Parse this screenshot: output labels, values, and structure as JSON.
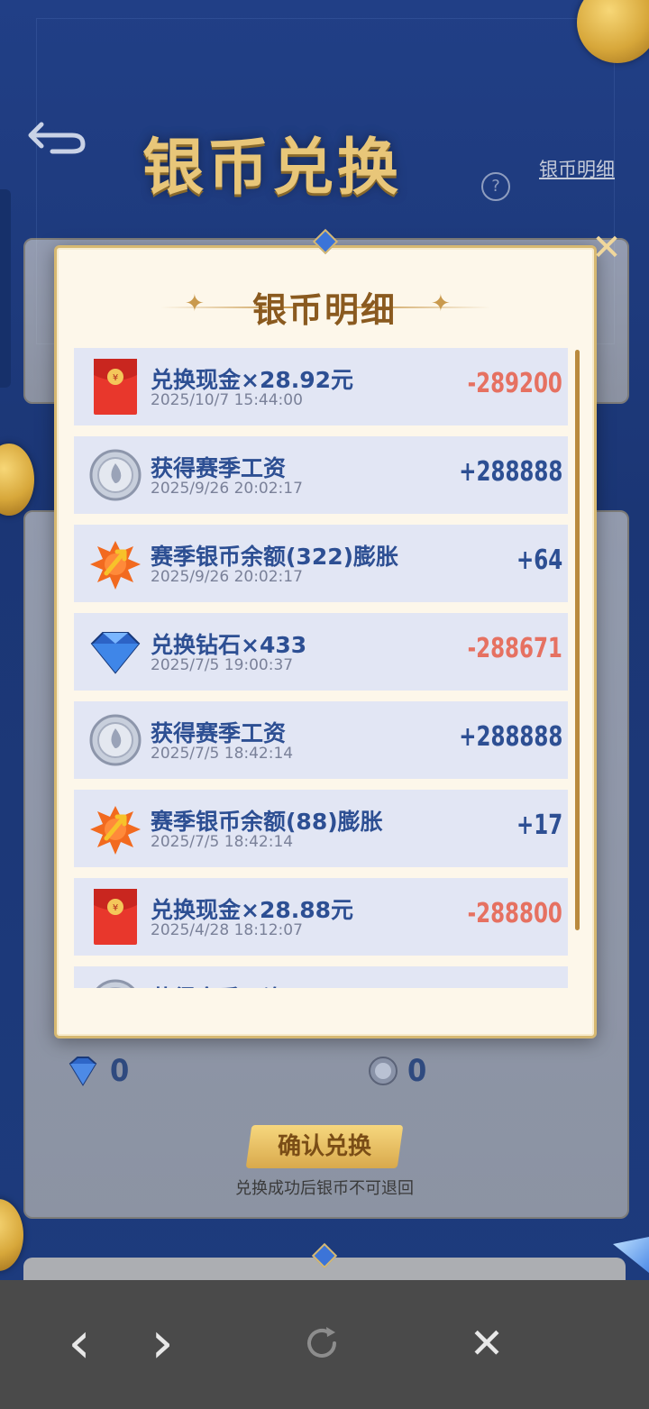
{
  "header": {
    "title": "银币兑换",
    "help_symbol": "?",
    "detail_link": "银币明细"
  },
  "modal": {
    "title": "银币明细",
    "close_symbol": "✕",
    "records": [
      {
        "icon": "red-envelope-icon",
        "title": "兑换现金×28.92元",
        "time": "2025/10/7 15:44:00",
        "amount": "-289200",
        "sign": "negative"
      },
      {
        "icon": "silver-coin-icon",
        "title": "获得赛季工资",
        "time": "2025/9/26 20:02:17",
        "amount": "+288888",
        "sign": "positive"
      },
      {
        "icon": "growth-burst-icon",
        "title": "赛季银币余额(322)膨胀",
        "time": "2025/9/26 20:02:17",
        "amount": "+64",
        "sign": "positive"
      },
      {
        "icon": "diamond-icon",
        "title": "兑换钻石×433",
        "time": "2025/7/5 19:00:37",
        "amount": "-288671",
        "sign": "negative"
      },
      {
        "icon": "silver-coin-icon",
        "title": "获得赛季工资",
        "time": "2025/7/5 18:42:14",
        "amount": "+288888",
        "sign": "positive"
      },
      {
        "icon": "growth-burst-icon",
        "title": "赛季银币余额(88)膨胀",
        "time": "2025/7/5 18:42:14",
        "amount": "+17",
        "sign": "positive"
      },
      {
        "icon": "red-envelope-icon",
        "title": "兑换现金×28.88元",
        "time": "2025/4/28 18:12:07",
        "amount": "-288800",
        "sign": "negative"
      },
      {
        "icon": "silver-coin-icon",
        "title": "获得赛季工资",
        "time": "",
        "amount": "",
        "sign": "positive"
      }
    ]
  },
  "exchange": {
    "diamond_amount": "0",
    "coin_amount": "0",
    "confirm_label": "确认兑换",
    "note": "兑换成功后银币不可退回"
  },
  "toolbar": {
    "back": "‹",
    "forward": "›",
    "close": "✕"
  },
  "colors": {
    "negative": "#e67161",
    "positive": "#2d4f93",
    "gold": "#d6b871"
  }
}
